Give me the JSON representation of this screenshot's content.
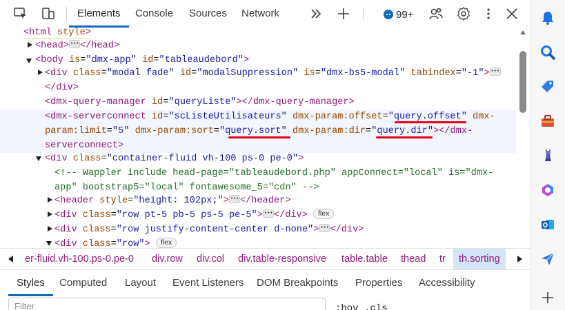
{
  "toolbar": {
    "tabs": [
      {
        "label": "Elements",
        "active": true
      },
      {
        "label": "Console",
        "active": false
      },
      {
        "label": "Sources",
        "active": false
      },
      {
        "label": "Network",
        "active": false
      }
    ],
    "issues_count": "99+",
    "icons": [
      "inspect-icon",
      "device-toolbar-icon",
      "more-tabs-icon",
      "add-tab-icon",
      "issues-icon",
      "customize-icon",
      "settings-icon",
      "more-options-icon",
      "close-icon"
    ]
  },
  "tree": {
    "lines": [
      {
        "parts": [
          [
            "tag",
            "<html "
          ],
          [
            "attr",
            "style"
          ],
          [
            "tag",
            ">"
          ]
        ]
      },
      {
        "parts": [
          [
            "tag",
            "<head>"
          ],
          [
            "ellipsis",
            ""
          ],
          [
            "tag",
            "</head>"
          ]
        ]
      },
      {
        "parts": [
          [
            "tag",
            "<body "
          ],
          [
            "attr",
            "is"
          ],
          [
            "eq",
            "="
          ],
          [
            "val",
            "\"dmx-app\""
          ],
          [
            "plain",
            " "
          ],
          [
            "attr",
            "id"
          ],
          [
            "eq",
            "="
          ],
          [
            "val",
            "\"tableaudebord\""
          ],
          [
            "tag",
            ">"
          ]
        ]
      },
      {
        "parts": [
          [
            "tag",
            "<div "
          ],
          [
            "attr",
            "class"
          ],
          [
            "eq",
            "="
          ],
          [
            "val",
            "\"modal fade\""
          ],
          [
            "plain",
            " "
          ],
          [
            "attr",
            "id"
          ],
          [
            "eq",
            "="
          ],
          [
            "val",
            "\"modalSuppression\""
          ],
          [
            "plain",
            " "
          ],
          [
            "attr",
            "is"
          ],
          [
            "eq",
            "="
          ],
          [
            "val",
            "\"dmx-bs5-modal\""
          ],
          [
            "plain",
            " "
          ],
          [
            "attr",
            "tabindex"
          ],
          [
            "eq",
            "="
          ],
          [
            "val",
            "\"-1\""
          ],
          [
            "tag",
            ">"
          ],
          [
            "ellipsis",
            ""
          ]
        ]
      },
      {
        "parts": [
          [
            "tag",
            "</div>"
          ]
        ]
      },
      {
        "parts": [
          [
            "tag",
            "<dmx-query-manager "
          ],
          [
            "attr",
            "id"
          ],
          [
            "eq",
            "="
          ],
          [
            "val",
            "\"queryListe\""
          ],
          [
            "tag",
            "></dmx-query-manager>"
          ]
        ]
      },
      {
        "parts": [
          [
            "tag",
            "<dmx-serverconnect "
          ],
          [
            "attr",
            "id"
          ],
          [
            "eq",
            "="
          ],
          [
            "val",
            "\"scListeUtilisateurs\""
          ],
          [
            "plain",
            " "
          ],
          [
            "attr",
            "dmx-param:offset"
          ],
          [
            "eq",
            "="
          ],
          [
            "val",
            "\"query.offset\""
          ],
          [
            "plain",
            " "
          ],
          [
            "attr",
            "dmx-"
          ]
        ]
      },
      {
        "parts": [
          [
            "attr",
            "param:limit"
          ],
          [
            "eq",
            "="
          ],
          [
            "val",
            "\"5\""
          ],
          [
            "plain",
            " "
          ],
          [
            "attr",
            "dmx-param:sort"
          ],
          [
            "eq",
            "="
          ],
          [
            "val",
            "\"query.sort\""
          ],
          [
            "plain",
            " "
          ],
          [
            "attr",
            "dmx-param:dir"
          ],
          [
            "eq",
            "="
          ],
          [
            "val",
            "\"query.dir\""
          ],
          [
            "tag",
            "></dmx-"
          ]
        ]
      },
      {
        "parts": [
          [
            "tag",
            "serverconnect>"
          ]
        ]
      },
      {
        "parts": [
          [
            "tag",
            "<div "
          ],
          [
            "attr",
            "class"
          ],
          [
            "eq",
            "="
          ],
          [
            "val",
            "\"container-fluid vh-100 ps-0 pe-0\""
          ],
          [
            "tag",
            ">"
          ]
        ]
      },
      {
        "parts": [
          [
            "cmt",
            "<!-- Wappler include head-page=\"tableaudebord.php\" appConnect=\"local\" is=\"dmx-"
          ]
        ]
      },
      {
        "parts": [
          [
            "cmt",
            "app\" bootstrap5=\"local\" fontawesome_5=\"cdn\" -->"
          ]
        ]
      },
      {
        "parts": [
          [
            "tag",
            "<header "
          ],
          [
            "attr",
            "style"
          ],
          [
            "eq",
            "="
          ],
          [
            "val",
            "\"height: 102px;\""
          ],
          [
            "tag",
            ">"
          ],
          [
            "ellipsis",
            ""
          ],
          [
            "tag",
            "</header>"
          ]
        ]
      },
      {
        "parts": [
          [
            "tag",
            "<div "
          ],
          [
            "attr",
            "class"
          ],
          [
            "eq",
            "="
          ],
          [
            "val",
            "\"row pt-5 pb-5 ps-5 pe-5\""
          ],
          [
            "tag",
            ">"
          ],
          [
            "ellipsis",
            ""
          ],
          [
            "tag",
            "</div>"
          ],
          [
            "pill",
            "flex"
          ]
        ]
      },
      {
        "parts": [
          [
            "tag",
            "<div "
          ],
          [
            "attr",
            "class"
          ],
          [
            "eq",
            "="
          ],
          [
            "val",
            "\"row justify-content-center d-none\""
          ],
          [
            "tag",
            ">"
          ],
          [
            "ellipsis",
            ""
          ],
          [
            "tag",
            "</div>"
          ]
        ]
      },
      {
        "parts": [
          [
            "tag",
            "<div "
          ],
          [
            "attr",
            "class"
          ],
          [
            "eq",
            "="
          ],
          [
            "val",
            "\"row\""
          ],
          [
            "tag",
            ">"
          ],
          [
            "pill",
            "flex"
          ]
        ]
      }
    ]
  },
  "breadcrumb": {
    "items": [
      {
        "label": "er-fluid.vh-100.ps-0.pe-0",
        "active": false
      },
      {
        "label": "div.row",
        "active": false
      },
      {
        "label": "div.col",
        "active": false
      },
      {
        "label": "div.table-responsive",
        "active": false
      },
      {
        "label": "table.table",
        "active": false
      },
      {
        "label": "thead",
        "active": false
      },
      {
        "label": "tr",
        "active": false
      },
      {
        "label": "th.sorting",
        "active": true
      }
    ]
  },
  "subtabs": [
    {
      "label": "Styles",
      "active": true
    },
    {
      "label": "Computed",
      "active": false
    },
    {
      "label": "Layout",
      "active": false
    },
    {
      "label": "Event Listeners",
      "active": false
    },
    {
      "label": "DOM Breakpoints",
      "active": false
    },
    {
      "label": "Properties",
      "active": false
    },
    {
      "label": "Accessibility",
      "active": false
    }
  ],
  "filter": {
    "placeholder": "Filter",
    "right_text": ":hov  .cls"
  },
  "colors": {
    "accent": "#0f6cbd",
    "tag": "#8e1a7d",
    "attr": "#994500",
    "value": "#1a1aa6",
    "comment": "#236e25",
    "annotation": "#e0001b"
  },
  "edge_sidebar": [
    "notification-bell-icon",
    "search-icon",
    "shopping-tag-icon",
    "toolbox-icon",
    "chess-icon",
    "microsoft-365-icon",
    "outlook-icon",
    "send-icon",
    "add-icon"
  ]
}
